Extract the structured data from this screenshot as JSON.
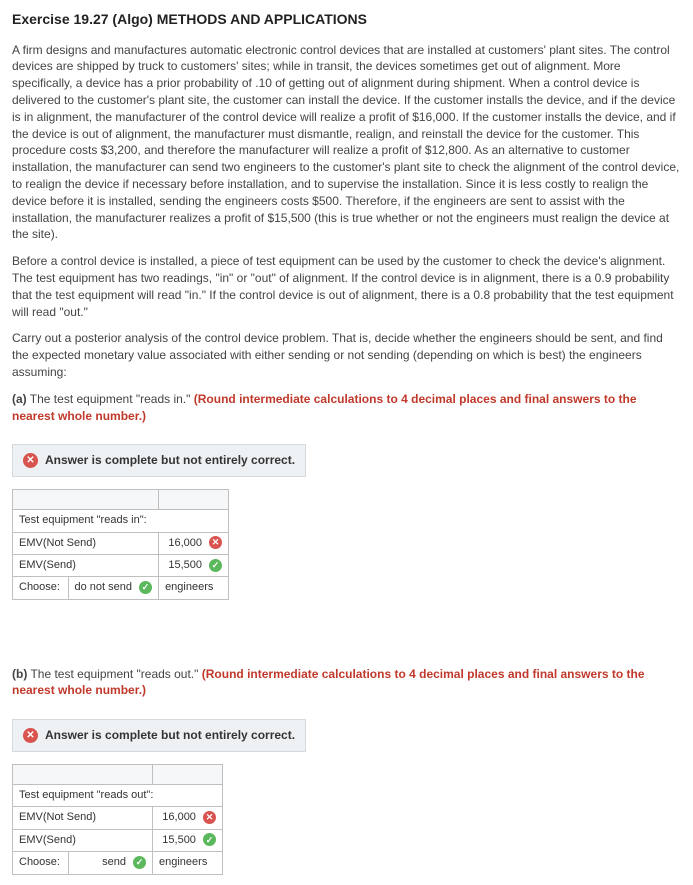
{
  "title": "Exercise 19.27 (Algo) METHODS AND APPLICATIONS",
  "para1": "A firm designs and manufactures automatic electronic control devices that are installed at customers' plant sites. The control devices are shipped by truck to customers' sites; while in transit, the devices sometimes get out of alignment. More specifically, a device has a prior probability of .10 of getting out of alignment during shipment. When a control device is delivered to the customer's plant site, the customer can install the device. If the customer installs the device, and if the device is in alignment, the manufacturer of the control device will realize a profit of $16,000. If the customer installs the device, and if the device is out of alignment, the manufacturer must dismantle, realign, and reinstall the device for the customer. This procedure costs $3,200, and therefore the manufacturer will realize a profit of $12,800. As an alternative to customer installation, the manufacturer can send two engineers to the customer's plant site to check the alignment of the control device, to realign the device if necessary before installation, and to supervise the installation. Since it is less costly to realign the device before it is installed, sending the engineers costs $500. Therefore, if the engineers are sent to assist with the installation, the manufacturer realizes a profit of $15,500 (this is true whether or not the engineers must realign the device at the site).",
  "para2": "Before a control device is installed, a piece of test equipment can be used by the customer to check the device's alignment. The test equipment has two readings, \"in\" or \"out\" of alignment. If the control device is in alignment, there is a 0.9 probability that the test equipment will read \"in.\" If the control device is out of alignment, there is a 0.8 probability that the test equipment will read \"out.\"",
  "para3": "Carry out a posterior analysis of the control device problem. That is, decide whether the engineers should be sent, and find the expected monetary value associated with either sending or not sending (depending on which is best) the engineers assuming:",
  "partA": {
    "label": "(a)",
    "text": "The test equipment \"reads in.\"",
    "instr": "(Round intermediate calculations to 4 decimal places and final answers to the nearest whole number.)",
    "status": "Answer is complete but not entirely correct.",
    "header": "Test equipment \"reads in\":",
    "rows": {
      "r1label": "EMV(Not Send)",
      "r1val": "16,000",
      "r1mark": "wrong",
      "r2label": "EMV(Send)",
      "r2val": "15,500",
      "r2mark": "right",
      "chooseLabel": "Choose:",
      "chooseVal": "do not send",
      "chooseMark": "right",
      "chooseSuffix": "engineers"
    }
  },
  "partB": {
    "label": "(b)",
    "text": "The test equipment \"reads out.\"",
    "instr": "(Round intermediate calculations to 4 decimal places and final answers to the nearest whole number.)",
    "status": "Answer is complete but not entirely correct.",
    "header": "Test equipment \"reads out\":",
    "rows": {
      "r1label": "EMV(Not Send)",
      "r1val": "16,000",
      "r1mark": "wrong",
      "r2label": "EMV(Send)",
      "r2val": "15,500",
      "r2mark": "right",
      "chooseLabel": "Choose:",
      "chooseVal": "send",
      "chooseMark": "right",
      "chooseSuffix": "engineers"
    }
  }
}
